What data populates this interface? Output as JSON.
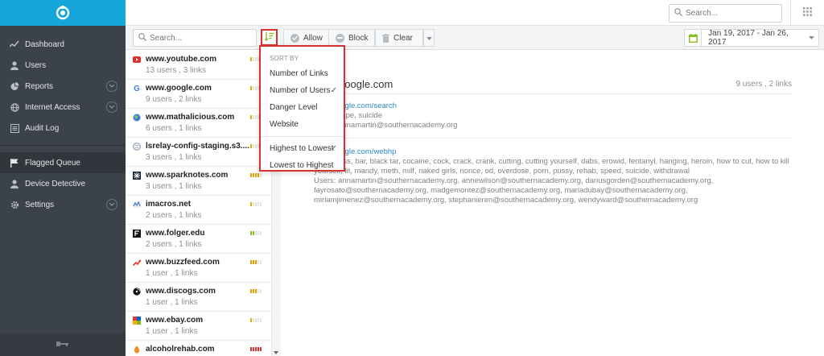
{
  "sidebar": {
    "items": [
      {
        "label": "Dashboard",
        "icon": "line-chart-icon",
        "chevron": false
      },
      {
        "label": "Users",
        "icon": "user-icon",
        "chevron": false
      },
      {
        "label": "Reports",
        "icon": "pie-chart-icon",
        "chevron": true
      },
      {
        "label": "Internet Access",
        "icon": "globe-icon",
        "chevron": true
      },
      {
        "label": "Audit Log",
        "icon": "list-icon",
        "chevron": false
      }
    ],
    "items2": [
      {
        "label": "Flagged Queue",
        "icon": "flag-icon",
        "chevron": false,
        "active": true
      },
      {
        "label": "Device Detective",
        "icon": "user-icon",
        "chevron": false
      },
      {
        "label": "Settings",
        "icon": "gear-icon",
        "chevron": true
      }
    ]
  },
  "topbar": {
    "search_placeholder": "Search..."
  },
  "toolbar": {
    "search_placeholder": "Search...",
    "allow_label": "Allow",
    "block_label": "Block",
    "clear_label": "Clear",
    "date_range": "Jan 19, 2017 - Jan 26, 2017"
  },
  "sites": [
    {
      "name": "www.youtube.com",
      "meta": "13 users , 3 links",
      "level": 1,
      "color": "#e0b000"
    },
    {
      "name": "www.google.com",
      "meta": "9 users , 2 links",
      "level": 1,
      "color": "#e0b000"
    },
    {
      "name": "www.mathalicious.com",
      "meta": "6 users , 1 links",
      "level": 1,
      "color": "#e0b000"
    },
    {
      "name": "lsrelay-config-staging.s3....",
      "meta": "3 users , 1 links",
      "level": 1,
      "color": "#e0b000"
    },
    {
      "name": "www.sparknotes.com",
      "meta": "3 users , 1 links",
      "level": 4,
      "color": "#e0a000"
    },
    {
      "name": "imacros.net",
      "meta": "2 users , 1 links",
      "level": 1,
      "color": "#e0b000"
    },
    {
      "name": "www.folger.edu",
      "meta": "2 users , 1 links",
      "level": 2,
      "color": "#8cbf26"
    },
    {
      "name": "www.buzzfeed.com",
      "meta": "1 user , 1 links",
      "level": 3,
      "color": "#e0a000"
    },
    {
      "name": "www.discogs.com",
      "meta": "1 user , 1 links",
      "level": 3,
      "color": "#e0a000"
    },
    {
      "name": "www.ebay.com",
      "meta": "1 user , 1 links",
      "level": 1,
      "color": "#e0b000"
    },
    {
      "name": "alcoholrehab.com",
      "meta": "",
      "level": 5,
      "color": "#d6302f"
    }
  ],
  "detail": {
    "title": "www.google.com",
    "summary": "9 users , 2 links",
    "links": [
      {
        "url": "www.google.com/search",
        "terms": "Terms: rape, suicide",
        "users": "Users: annamartin@southernacademy.org"
      },
      {
        "url": "www.google.com/webhp",
        "terms": "Terms: ass, bar, black tar, cocaine, cock, crack, crank, cutting, cutting yourself, dabs, erowid, fentanyl, hanging, heroin, how to cut, how to kill yourself, lit, mandy, meth, milf, naked girls, nonce, od, overdose, porn, pussy, rehab, speed, suicide, withdrawal",
        "users": "Users: annamartin@southernacademy.org, annewilson@southernacademy.org, dariusgorden@southernacademy.org, fayrosato@southernacademy.org, madgemontez@southernacademy.org, mariadubay@southernacademy.org, miriamjimenez@southernacademy.org, stephanieren@southernacademy.org, wendyward@southernacademy.org"
      }
    ]
  },
  "sort_menu": {
    "header": "SORT BY",
    "fields": [
      {
        "label": "Number of Links",
        "checked": false
      },
      {
        "label": "Number of Users",
        "checked": true
      },
      {
        "label": "Danger Level",
        "checked": false
      },
      {
        "label": "Website",
        "checked": false
      }
    ],
    "orders": [
      {
        "label": "Highest to Lowest",
        "checked": true
      },
      {
        "label": "Lowest to Highest",
        "checked": false
      }
    ],
    "check": "✓"
  }
}
